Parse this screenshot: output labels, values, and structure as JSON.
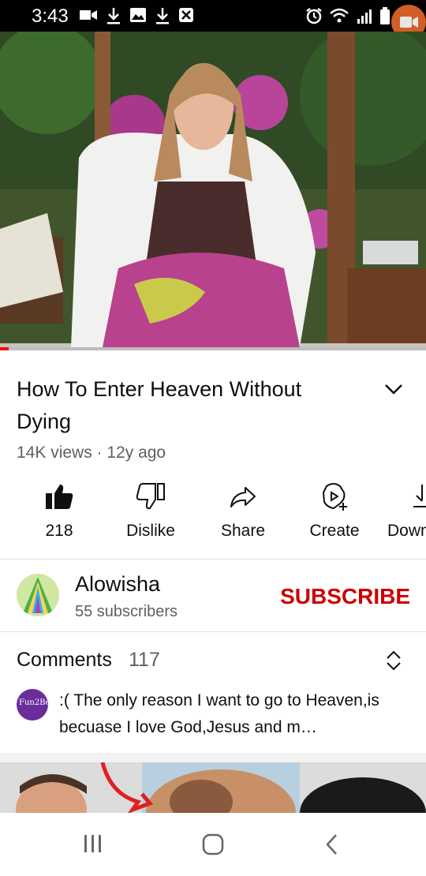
{
  "status_bar": {
    "time": "3:43",
    "left_icons": [
      "video-camera-icon",
      "download-icon",
      "image-icon",
      "download-icon",
      "close-box-icon"
    ],
    "right_icons": [
      "alarm-icon",
      "wifi-icon",
      "signal-icon",
      "battery-icon"
    ],
    "record_icon": "screen-record-icon"
  },
  "video": {
    "progress": 0.02,
    "colors": {
      "played": "#ff0000",
      "buffer": "#bdbdbd"
    }
  },
  "title": "How To Enter Heaven Without Dying",
  "meta": "14K views · 12y ago",
  "actions": [
    {
      "icon": "thumbs-up-icon",
      "label": "218"
    },
    {
      "icon": "thumbs-down-icon",
      "label": "Dislike"
    },
    {
      "icon": "share-icon",
      "label": "Share"
    },
    {
      "icon": "create-icon",
      "label": "Create"
    },
    {
      "icon": "download-icon",
      "label": "Down"
    }
  ],
  "channel": {
    "name": "Alowisha",
    "subscribers": "55 subscribers",
    "subscribe_label": "SUBSCRIBE",
    "subscribe_color": "#cc0000"
  },
  "comments": {
    "title": "Comments",
    "count": "117",
    "first_comment": ":( The only reason I want to go to Heaven,is becuase I love God,Jesus and m…",
    "avatar_text": "Fun2Be"
  },
  "nav": [
    "recents-icon",
    "home-icon",
    "back-icon"
  ]
}
